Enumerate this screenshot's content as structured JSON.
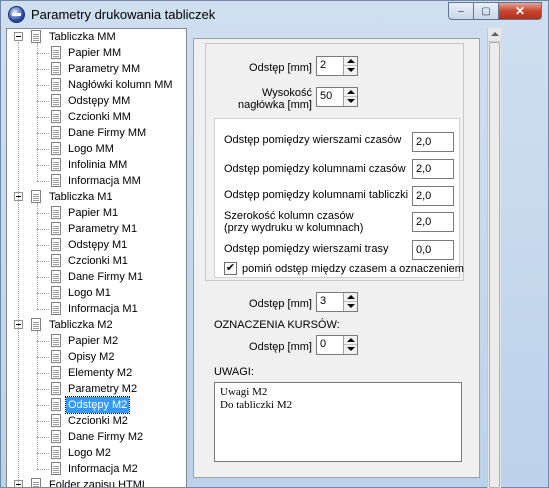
{
  "window": {
    "title": "Parametry drukowania tabliczek",
    "minimize": "‒",
    "maximize": "▢",
    "close": "✕"
  },
  "tree": [
    {
      "label": "Tabliczka MM",
      "level": 0
    },
    {
      "label": "Papier MM",
      "level": 1
    },
    {
      "label": "Parametry MM",
      "level": 1
    },
    {
      "label": "Nagłówki kolumn MM",
      "level": 1
    },
    {
      "label": "Odstępy MM",
      "level": 1
    },
    {
      "label": "Czcionki MM",
      "level": 1
    },
    {
      "label": "Dane Firmy MM",
      "level": 1
    },
    {
      "label": "Logo MM",
      "level": 1
    },
    {
      "label": "Infolinia MM",
      "level": 1
    },
    {
      "label": "Informacja MM",
      "level": 1
    },
    {
      "label": "Tabliczka M1",
      "level": 0
    },
    {
      "label": "Papier M1",
      "level": 1
    },
    {
      "label": "Parametry M1",
      "level": 1
    },
    {
      "label": "Odstępy M1",
      "level": 1
    },
    {
      "label": "Czcionki M1",
      "level": 1
    },
    {
      "label": "Dane Firmy M1",
      "level": 1
    },
    {
      "label": "Logo M1",
      "level": 1
    },
    {
      "label": "Informacja M1",
      "level": 1
    },
    {
      "label": "Tabliczka M2",
      "level": 0
    },
    {
      "label": "Papier M2",
      "level": 1
    },
    {
      "label": "Opisy M2",
      "level": 1
    },
    {
      "label": "Elementy M2",
      "level": 1
    },
    {
      "label": "Parametry M2",
      "level": 1
    },
    {
      "label": "Odstępy M2",
      "level": 1,
      "selected": true
    },
    {
      "label": "Czcionki M2",
      "level": 1
    },
    {
      "label": "Dane Firmy M2",
      "level": 1
    },
    {
      "label": "Logo M2",
      "level": 1
    },
    {
      "label": "Informacja M2",
      "level": 1
    },
    {
      "label": "Folder zapisu HTML",
      "level": 0
    }
  ],
  "form": {
    "odstep_label": "Odstęp [mm]",
    "odstep_value": "2",
    "wysokosc_label_1": "Wysokość",
    "wysokosc_label_2": "nagłówka [mm]",
    "wysokosc_value": "50",
    "rows": [
      {
        "label": "Odstęp pomiędzy wierszami  czasów",
        "value": "2,0"
      },
      {
        "label": "Odstęp pomiędzy kolumnami czasów",
        "value": "2,0"
      },
      {
        "label": "Odstęp pomiędzy kolumnami tabliczki",
        "value": "2,0"
      },
      {
        "label": "Szerokość kolumn czasów",
        "label2": "(przy wydruku w kolumnach)",
        "value": "2,0"
      },
      {
        "label": "Odstęp pomiędzy wierszami trasy",
        "value": "0,0"
      }
    ],
    "checkbox_label": "pomiń odstęp między czasem a oznaczeniem",
    "checkbox_checked": "✔",
    "odstep2_label": "Odstęp [mm]",
    "odstep2_value": "3",
    "oznaczenia_label": "OZNACZENIA  KURSÓW:",
    "odstep3_label": "Odstęp [mm]",
    "odstep3_value": "0",
    "uwagi_label": "UWAGI:",
    "uwagi_line1": "Uwagi M2",
    "uwagi_line2": "Do tabliczki M2"
  }
}
